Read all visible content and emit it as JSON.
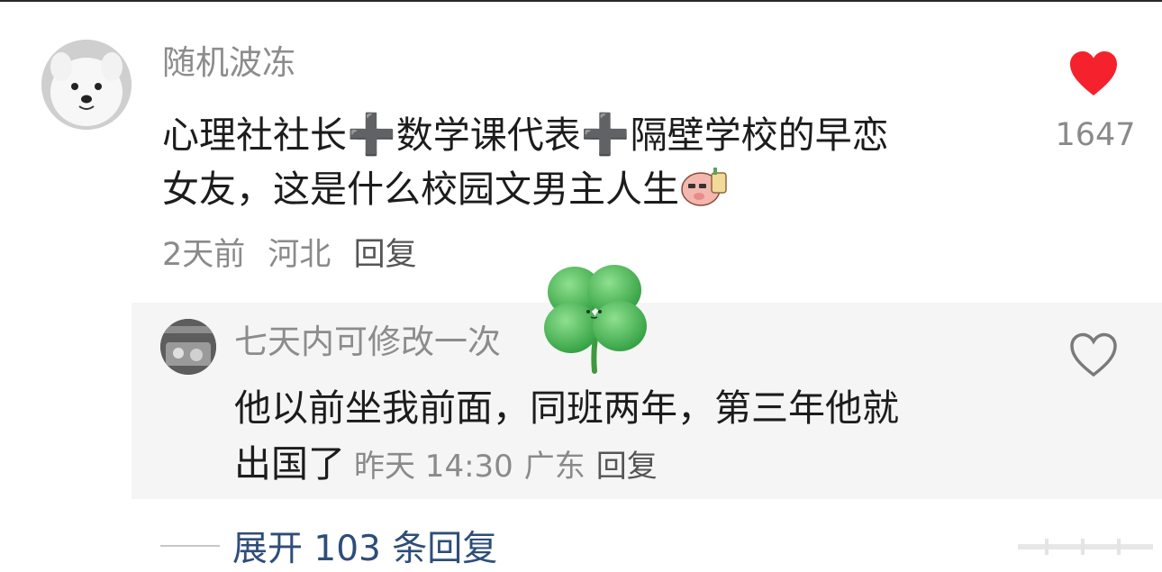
{
  "comment": {
    "username": "随机波冻",
    "text_line1_a": "心理社社长",
    "plus": "➕",
    "text_line1_b": "数学课代表",
    "text_line1_c": "隔壁学校的早恋",
    "text_line2": "女友，这是什么校园文男主人生",
    "time": "2天前",
    "location": "河北",
    "reply_label": "回复",
    "likes": "1647",
    "liked": true,
    "like_color": "#f5222d"
  },
  "reply": {
    "username": "七天内可修改一次",
    "text_line1": "他以前坐我前面，同班两年，第三年他就",
    "text_line2": "出国了",
    "time": "昨天 14:30",
    "location": "广东",
    "reply_label": "回复",
    "liked": false
  },
  "expand": {
    "label": "展开 103 条回复",
    "link_color": "#2e4d7a"
  },
  "icons": {
    "like_filled": "heart-filled-icon",
    "like_outline": "heart-outline-icon",
    "sticker": "pig-emoji-icon",
    "clover": "four-leaf-clover-icon"
  }
}
